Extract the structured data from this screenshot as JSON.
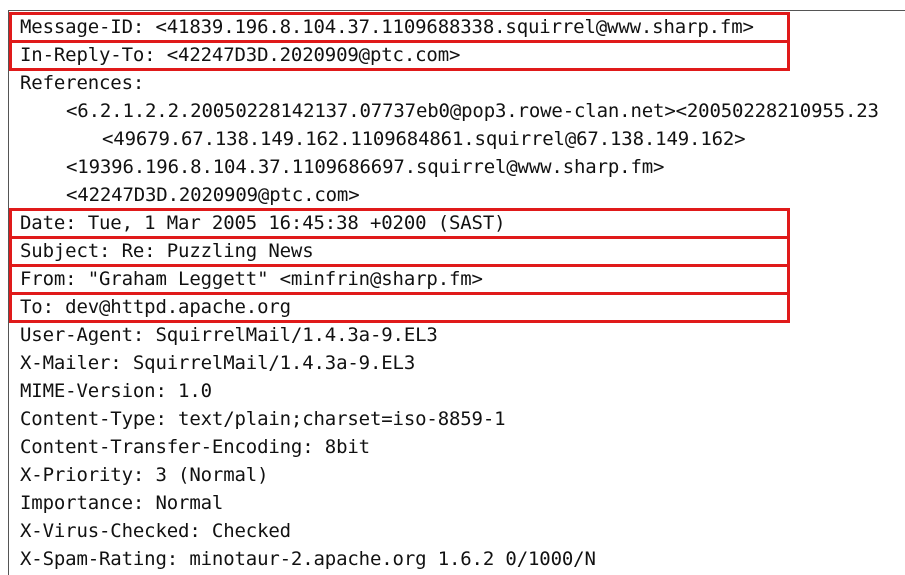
{
  "headers": {
    "message_id": "Message-ID: <41839.196.8.104.37.1109688338.squirrel@www.sharp.fm>",
    "in_reply_to": "In-Reply-To: <42247D3D.2020909@ptc.com>",
    "references_label": "References:",
    "references": [
      "<6.2.1.2.2.20050228142137.07737eb0@pop3.rowe-clan.net><20050228210955.23",
      "<49679.67.138.149.162.1109684861.squirrel@67.138.149.162>",
      "<19396.196.8.104.37.1109686697.squirrel@www.sharp.fm>",
      "<42247D3D.2020909@ptc.com>"
    ],
    "date": "Date: Tue, 1 Mar 2005 16:45:38 +0200 (SAST)",
    "subject": "Subject: Re: Puzzling News",
    "from": "From: \"Graham Leggett\" <minfrin@sharp.fm>",
    "to": "To: dev@httpd.apache.org",
    "user_agent": "User-Agent: SquirrelMail/1.4.3a-9.EL3",
    "x_mailer": "X-Mailer: SquirrelMail/1.4.3a-9.EL3",
    "mime_version": "MIME-Version: 1.0",
    "content_type": "Content-Type: text/plain;charset=iso-8859-1",
    "content_transfer_encoding": "Content-Transfer-Encoding: 8bit",
    "x_priority": "X-Priority: 3 (Normal)",
    "importance": "Importance: Normal",
    "x_virus_checked": "X-Virus-Checked: Checked",
    "x_spam_rating": "X-Spam-Rating: minotaur-2.apache.org 1.6.2 0/1000/N"
  },
  "colors": {
    "highlight": "#e01a1a",
    "text": "#111111"
  }
}
